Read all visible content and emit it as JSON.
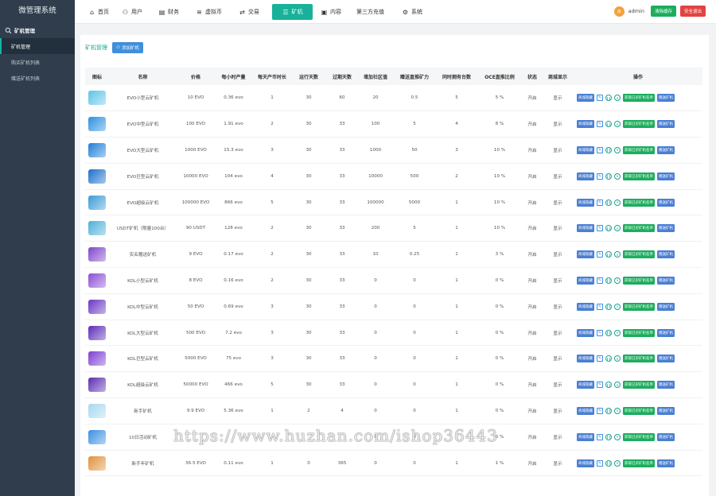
{
  "sidebar": {
    "title": "微管理系统",
    "group_label": "矿机管理",
    "items": [
      {
        "label": "矿机管理",
        "active": true
      },
      {
        "label": "购买矿机列表",
        "active": false
      },
      {
        "label": "赠送矿机列表",
        "active": false
      }
    ]
  },
  "topnav": {
    "items": [
      {
        "label": "首页",
        "icon": "home-icon",
        "glyph": "⌂"
      },
      {
        "label": "用户",
        "icon": "user-icon",
        "glyph": "👤"
      },
      {
        "label": "财务",
        "icon": "finance-icon",
        "glyph": "▤"
      },
      {
        "label": "虚拟币",
        "icon": "coin-icon",
        "glyph": "≋"
      },
      {
        "label": "交易",
        "icon": "trade-icon",
        "glyph": "⇄"
      },
      {
        "label": "矿机",
        "icon": "miner-icon",
        "glyph": "☰",
        "active": true
      },
      {
        "label": "内容",
        "icon": "content-icon",
        "glyph": "▣"
      },
      {
        "label": "第三方充值",
        "icon": "recharge-icon",
        "glyph": ""
      },
      {
        "label": "系统",
        "icon": "gear-icon",
        "glyph": "⚙"
      }
    ],
    "avatar_letter": "a",
    "admin_name": "admin",
    "clear_cache": "清除缓存",
    "logout": "安全退出"
  },
  "panel": {
    "title": "矿机管理",
    "add_button": "添加矿机"
  },
  "table": {
    "headers": [
      "图标",
      "名称",
      "价格",
      "每小时产量",
      "每天产币时长",
      "运行天数",
      "过期天数",
      "增加社区值",
      "赠送直推矿力",
      "同时拥有台数",
      "OCE直推比例",
      "状态",
      "商城显示",
      "操作"
    ],
    "op_labels": {
      "mall": "商城隐藏",
      "buyers": "获取已买矿机名单",
      "give": "赠送矿机"
    },
    "rows": [
      {
        "name": "EVO小型云矿机",
        "price": "10 EVO",
        "hourly": "0.36 evo",
        "hours": "1",
        "run_days": "30",
        "expire_days": "60",
        "community": "20",
        "gift_power": "0.5",
        "own": "5",
        "ratio": "5 %",
        "status": "开启",
        "mall": "显示",
        "color": "#5cc4e6"
      },
      {
        "name": "EVO中型云矿机",
        "price": "100 EVO",
        "hourly": "1.91 evo",
        "hours": "2",
        "run_days": "30",
        "expire_days": "33",
        "community": "100",
        "gift_power": "5",
        "own": "4",
        "ratio": "8 %",
        "status": "开启",
        "mall": "显示",
        "color": "#2a8fe0"
      },
      {
        "name": "EVO大型云矿机",
        "price": "1000 EVO",
        "hourly": "15.3 evo",
        "hours": "3",
        "run_days": "30",
        "expire_days": "33",
        "community": "1000",
        "gift_power": "50",
        "own": "3",
        "ratio": "10 %",
        "status": "开启",
        "mall": "显示",
        "color": "#1f7fd8"
      },
      {
        "name": "EVO巨型云矿机",
        "price": "10000 EVO",
        "hourly": "104 evo",
        "hours": "4",
        "run_days": "30",
        "expire_days": "33",
        "community": "10000",
        "gift_power": "500",
        "own": "2",
        "ratio": "10 %",
        "status": "开启",
        "mall": "显示",
        "color": "#1a6fcc"
      },
      {
        "name": "EVO超级云矿机",
        "price": "100000 EVO",
        "hourly": "866 evo",
        "hours": "5",
        "run_days": "30",
        "expire_days": "33",
        "community": "100000",
        "gift_power": "5000",
        "own": "1",
        "ratio": "10 %",
        "status": "开启",
        "mall": "显示",
        "color": "#3a9ad6"
      },
      {
        "name": "USDT矿机（限量100台）",
        "price": "90 USDT",
        "hourly": "128 evo",
        "hours": "2",
        "run_days": "30",
        "expire_days": "33",
        "community": "200",
        "gift_power": "5",
        "own": "1",
        "ratio": "10 %",
        "status": "开启",
        "mall": "显示",
        "color": "#4bb0d8"
      },
      {
        "name": "实名赠送矿机",
        "price": "9 EVO",
        "hourly": "0.17 evo",
        "hours": "2",
        "run_days": "30",
        "expire_days": "33",
        "community": "10",
        "gift_power": "0.25",
        "own": "1",
        "ratio": "3 %",
        "status": "开启",
        "mall": "显示",
        "color": "#7f45cc"
      },
      {
        "name": "KOL小型云矿机",
        "price": "8 EVO",
        "hourly": "0.16 evo",
        "hours": "2",
        "run_days": "30",
        "expire_days": "33",
        "community": "0",
        "gift_power": "0",
        "own": "1",
        "ratio": "0 %",
        "status": "开启",
        "mall": "显示",
        "color": "#8a4ed6"
      },
      {
        "name": "KOL中型云矿机",
        "price": "50 EVO",
        "hourly": "0.69 evo",
        "hours": "3",
        "run_days": "30",
        "expire_days": "33",
        "community": "0",
        "gift_power": "0",
        "own": "1",
        "ratio": "0 %",
        "status": "开启",
        "mall": "显示",
        "color": "#6a35c4"
      },
      {
        "name": "KOL大型云矿机",
        "price": "500 EVO",
        "hourly": "7.2 evo",
        "hours": "3",
        "run_days": "30",
        "expire_days": "33",
        "community": "0",
        "gift_power": "0",
        "own": "1",
        "ratio": "0 %",
        "status": "开启",
        "mall": "显示",
        "color": "#5a2cb8"
      },
      {
        "name": "KOL巨型云矿机",
        "price": "5000 EVO",
        "hourly": "75 evo",
        "hours": "3",
        "run_days": "30",
        "expire_days": "33",
        "community": "0",
        "gift_power": "0",
        "own": "1",
        "ratio": "0 %",
        "status": "开启",
        "mall": "显示",
        "color": "#7b3fd2"
      },
      {
        "name": "KOL超级云矿机",
        "price": "50000 EVO",
        "hourly": "466 evo",
        "hours": "5",
        "run_days": "30",
        "expire_days": "33",
        "community": "0",
        "gift_power": "0",
        "own": "1",
        "ratio": "0 %",
        "status": "开启",
        "mall": "显示",
        "color": "#5b2db0"
      },
      {
        "name": "新手矿机",
        "price": "9.9 EVO",
        "hourly": "5.36 evo",
        "hours": "1",
        "run_days": "2",
        "expire_days": "4",
        "community": "0",
        "gift_power": "0",
        "own": "1",
        "ratio": "0 %",
        "status": "开启",
        "mall": "显示",
        "color": "#a8d8f0"
      },
      {
        "name": "10日活动矿机",
        "price": "",
        "hourly": "",
        "hours": "",
        "run_days": "",
        "expire_days": "",
        "community": "0",
        "gift_power": "0",
        "own": "1",
        "ratio": "0 %",
        "status": "开启",
        "mall": "显示",
        "color": "#3a8fe0"
      },
      {
        "name": "新手年矿机",
        "price": "36.5 EVO",
        "hourly": "0.11 evo",
        "hours": "1",
        "run_days": "0",
        "expire_days": "365",
        "community": "0",
        "gift_power": "0",
        "own": "1",
        "ratio": "1 %",
        "status": "开启",
        "mall": "显示",
        "color": "#e0913a"
      }
    ]
  },
  "watermark": "https://www.huzhan.com/ishop36443"
}
